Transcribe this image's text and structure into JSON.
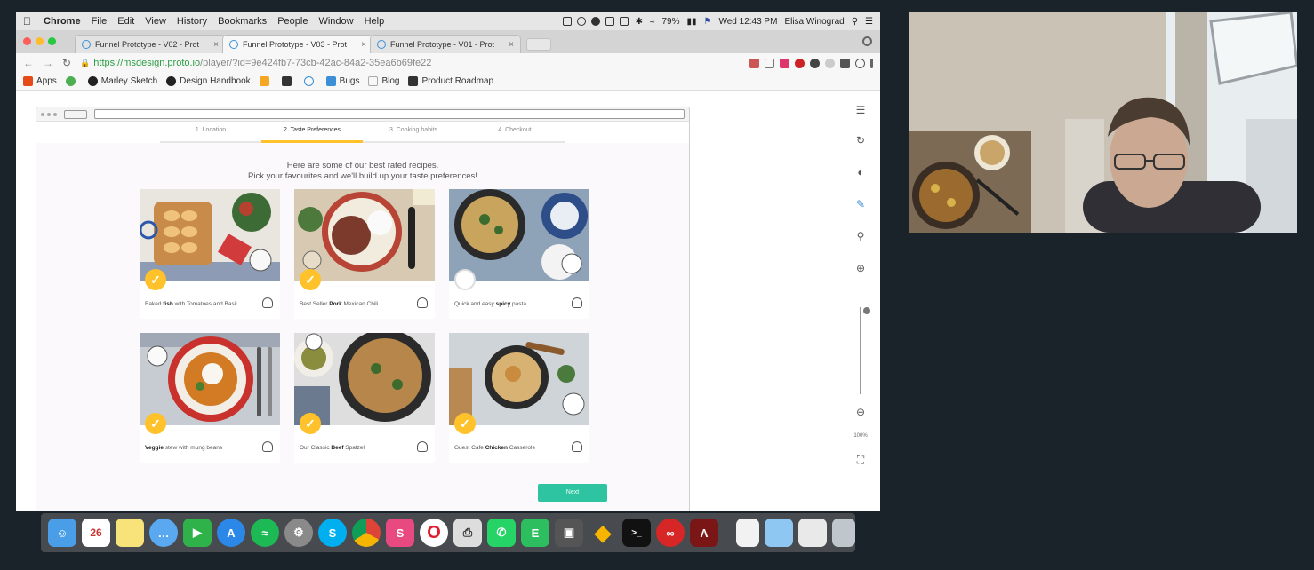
{
  "menubar": {
    "app_name": "Chrome",
    "menus": [
      "File",
      "Edit",
      "View",
      "History",
      "Bookmarks",
      "People",
      "Window",
      "Help"
    ],
    "battery": "79%",
    "datetime": "Wed 12:43 PM",
    "user": "Elisa Winograd"
  },
  "tabs": [
    {
      "title": "Funnel Prototype - V02 - Prot"
    },
    {
      "title": "Funnel Prototype - V03 - Prot"
    },
    {
      "title": "Funnel Prototype - V01 - Prot"
    }
  ],
  "address": {
    "scheme_host": "https://msdesign.proto.io",
    "path": "/player/?id=9e424fb7-73cb-42ac-84a2-35ea6b69fe22"
  },
  "bookmarks": [
    {
      "label": "Apps",
      "color": "#e64a19"
    },
    {
      "label": "",
      "color": "#4caf50"
    },
    {
      "label": "Marley Sketch",
      "color": "#222222"
    },
    {
      "label": "Design Handbook",
      "color": "#222222"
    },
    {
      "label": "",
      "color": "#f5a623"
    },
    {
      "label": "",
      "color": "#333333"
    },
    {
      "label": "",
      "color": "#3b8fd6"
    },
    {
      "label": "Bugs",
      "color": "#3b8fd6"
    },
    {
      "label": "Blog",
      "color": "#aaaaaa"
    },
    {
      "label": "Product Roadmap",
      "color": "#333333"
    }
  ],
  "prototype": {
    "steps": [
      "1. Location",
      "2. Taste Preferences",
      "3. Cooking habits",
      "4. Checkout"
    ],
    "active_step": 1,
    "intro_line1": "Here are some of our best rated recipes.",
    "intro_line2": "Pick your favourites and we'll build up your taste preferences!",
    "recipes": [
      {
        "pre": "Baked ",
        "bold": "fish",
        "post": " with Tomatoes and Basil",
        "selected": true
      },
      {
        "pre": "Best Seller ",
        "bold": "Pork",
        "post": " Mexican Chili",
        "selected": true
      },
      {
        "pre": "Quick and easy ",
        "bold": "spicy",
        "post": " pasta",
        "selected": false
      },
      {
        "pre": "",
        "bold": "Veggie",
        "post": " stew with mung beans",
        "selected": true
      },
      {
        "pre": "Our Classic ",
        "bold": "Beef",
        "post": " Spatzel",
        "selected": true
      },
      {
        "pre": "Guest Cafe ",
        "bold": "Chicken",
        "post": " Casserole",
        "selected": true
      }
    ],
    "next_label": "Next",
    "zoom_label": "100%"
  },
  "colors": {
    "accent_yellow": "#ffc22a",
    "next_green": "#2ec4a1"
  }
}
